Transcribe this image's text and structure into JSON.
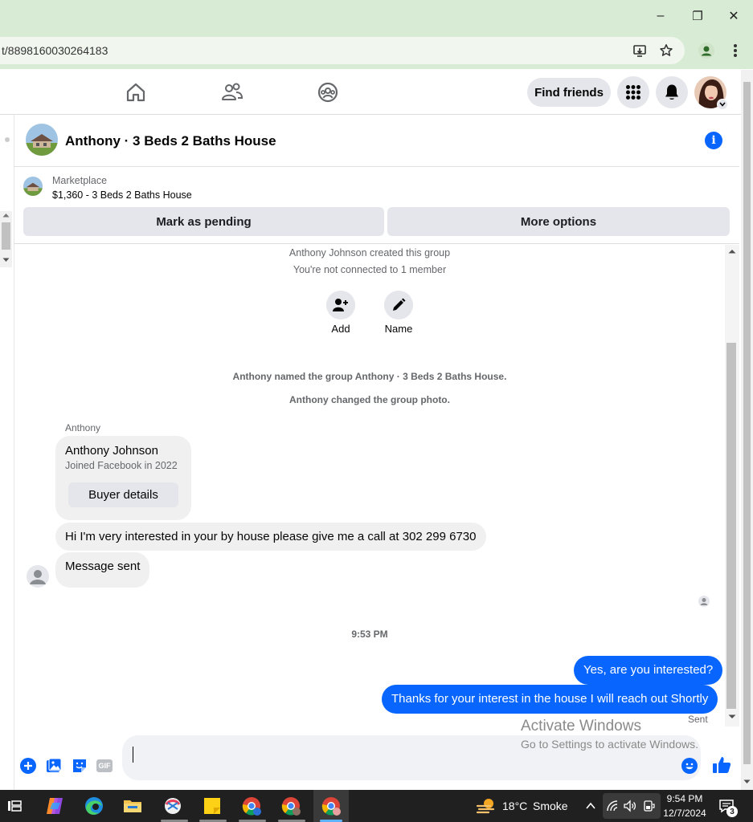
{
  "browser": {
    "url": "t/8898160030264183",
    "min_glyph": "–",
    "max_glyph": "❐",
    "close_glyph": "✕"
  },
  "topbar": {
    "find_friends": "Find friends"
  },
  "conversation": {
    "title": "Anthony · 3 Beds 2 Baths House",
    "info_glyph": "i"
  },
  "marketplace": {
    "label": "Marketplace",
    "listing": "$1,360 - 3 Beds 2 Baths House",
    "mark_pending": "Mark as pending",
    "more_options": "More options"
  },
  "messages": {
    "created": "Anthony Johnson created this group",
    "not_connected": "You're not connected to 1 member",
    "add_label": "Add",
    "name_label": "Name",
    "named_event": "Anthony named the group Anthony · 3 Beds 2 Baths House.",
    "photo_event": "Anthony changed the group photo.",
    "sender": "Anthony",
    "card_name": "Anthony Johnson",
    "card_joined": "Joined Facebook in 2022",
    "buyer_details": "Buyer details",
    "msg1": "Hi I'm very interested in your by house please give me a call at 302 299 6730",
    "msg2": "Message sent",
    "time": "9:53 PM",
    "out1": "Yes, are you interested?",
    "out2": "Thanks for your interest in the house I will reach out Shortly",
    "status": "Sent"
  },
  "composer": {
    "gif_label": "GIF"
  },
  "watermark": {
    "title": "Activate Windows",
    "subtitle": "Go to Settings to activate Windows."
  },
  "taskbar": {
    "temperature": "18°C",
    "weather": "Smoke",
    "time": "9:54 PM",
    "date": "12/7/2024",
    "notif_count": "3"
  },
  "colors": {
    "accent": "#0866ff",
    "bubble_in": "#f0f0f0",
    "chrome_green": "#d8ebd5"
  }
}
